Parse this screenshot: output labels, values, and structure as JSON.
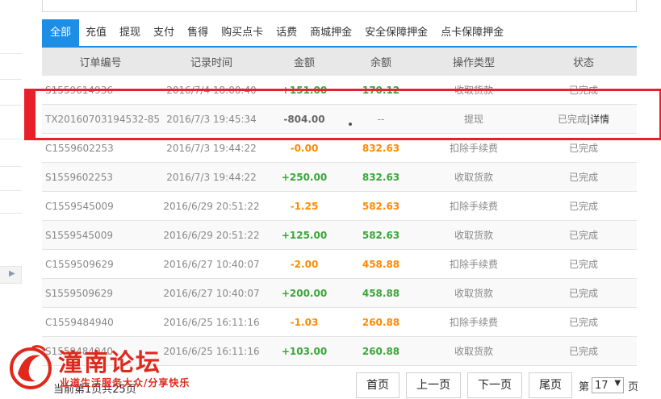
{
  "tabs": [
    {
      "label": "全部",
      "active": true
    },
    {
      "label": "充值"
    },
    {
      "label": "提现"
    },
    {
      "label": "支付"
    },
    {
      "label": "售得"
    },
    {
      "label": "购买点卡"
    },
    {
      "label": "话费"
    },
    {
      "label": "商城押金"
    },
    {
      "label": "安全保障押金"
    },
    {
      "label": "点卡保障押金"
    }
  ],
  "table": {
    "headers": [
      "订单编号",
      "记录时间",
      "金额",
      "余额",
      "操作类型",
      "状态"
    ],
    "rows": [
      {
        "order": "S1559614936",
        "time": "2016/7/4 18:00:40",
        "amount": "+151.00",
        "balance": "170.12",
        "type": "收取货款",
        "status": "已完成",
        "detail": ""
      },
      {
        "order": "TX20160703194532-85419",
        "time": "2016/7/3 19:45:34",
        "amount": "-804.00",
        "balance": "--",
        "type": "提现",
        "status": "已完成",
        "detail": "|详情"
      },
      {
        "order": "C1559602253",
        "time": "2016/7/3 19:44:22",
        "amount": "-0.00",
        "balance": "832.63",
        "type": "扣除手续费",
        "status": "已完成",
        "detail": ""
      },
      {
        "order": "S1559602253",
        "time": "2016/7/3 19:44:22",
        "amount": "+250.00",
        "balance": "832.63",
        "type": "收取货款",
        "status": "已完成",
        "detail": ""
      },
      {
        "order": "C1559545009",
        "time": "2016/6/29 20:51:22",
        "amount": "-1.25",
        "balance": "582.63",
        "type": "扣除手续费",
        "status": "已完成",
        "detail": ""
      },
      {
        "order": "S1559545009",
        "time": "2016/6/29 20:51:22",
        "amount": "+125.00",
        "balance": "582.63",
        "type": "收取货款",
        "status": "已完成",
        "detail": ""
      },
      {
        "order": "C1559509629",
        "time": "2016/6/27 10:40:07",
        "amount": "-2.00",
        "balance": "458.88",
        "type": "扣除手续费",
        "status": "已完成",
        "detail": ""
      },
      {
        "order": "S1559509629",
        "time": "2016/6/27 10:40:07",
        "amount": "+200.00",
        "balance": "458.88",
        "type": "收取货款",
        "status": "已完成",
        "detail": ""
      },
      {
        "order": "C1559484940",
        "time": "2016/6/25 16:11:16",
        "amount": "-1.03",
        "balance": "260.88",
        "type": "扣除手续费",
        "status": "已完成",
        "detail": ""
      },
      {
        "order": "S1559484940",
        "time": "2016/6/25 16:11:16",
        "amount": "+103.00",
        "balance": "260.88",
        "type": "收取货款",
        "status": "已完成",
        "detail": ""
      }
    ]
  },
  "footer": {
    "summary": "当前第1页共25页",
    "first": "首页",
    "prev": "上一页",
    "next": "下一页",
    "last": "尾页",
    "page_prefix": "第",
    "page_value": "17",
    "page_suffix": "页"
  },
  "watermark": {
    "title": "潼南论坛",
    "subtitle": "业道生活服务大众/分享快乐"
  },
  "colors": {
    "accent": "#1e8ee4",
    "positive": "#3aa63a",
    "negative": "#ff8a00",
    "highlight": "#e8202a"
  }
}
